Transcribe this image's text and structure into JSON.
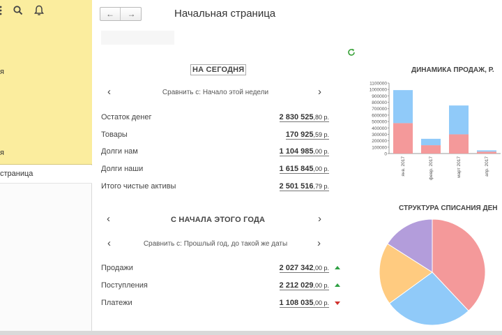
{
  "sidebar": {
    "icons": [
      "menu-icon",
      "search-icon",
      "bell-icon"
    ],
    "snippet_1": "я",
    "snippet_2": "я",
    "active_tab": "страница"
  },
  "header": {
    "back_label": "←",
    "forward_label": "→",
    "title": "Начальная страница"
  },
  "today": {
    "title": "НА СЕГОДНЯ",
    "compare": "Сравнить с: Начало этой недели",
    "rows": [
      {
        "label": "Остаток денег",
        "int": "2 830 525",
        "dec": ",80 р."
      },
      {
        "label": "Товары",
        "int": "170 925",
        "dec": ",59 р."
      },
      {
        "label": "Долги нам",
        "int": "1 104 985",
        "dec": ",00 р."
      },
      {
        "label": "Долги наши",
        "int": "1 615 845",
        "dec": ",00 р."
      },
      {
        "label": "Итого чистые активы",
        "int": "2 501 516",
        "dec": ",79 р."
      }
    ]
  },
  "year": {
    "title": "С НАЧАЛА ЭТОГО ГОДА",
    "compare": "Сравнить с: Прошлый год, до такой же даты",
    "rows": [
      {
        "label": "Продажи",
        "int": "2 027 342",
        "dec": ",00 р.",
        "trend": "up"
      },
      {
        "label": "Поступления",
        "int": "2 212 029",
        "dec": ",00 р.",
        "trend": "up"
      },
      {
        "label": "Платежи",
        "int": "1 108 035",
        "dec": ",00 р.",
        "trend": "down"
      }
    ]
  },
  "colors": {
    "sidebar_yellow": "#fbed9e",
    "bar_blue": "#90caf9",
    "bar_red": "#f4999a",
    "trend_up": "#2ea043",
    "trend_down": "#d0312d"
  },
  "chart_data": [
    {
      "type": "bar",
      "title": "ДИНАМИКА ПРОДАЖ, Р.",
      "stacked": true,
      "categories": [
        "янв. 2017",
        "февр. 2017",
        "март 2017",
        "апр. 2017"
      ],
      "series": [
        {
          "color": "#f4999a",
          "values": [
            475000,
            130000,
            300000,
            30000
          ]
        },
        {
          "color": "#90caf9",
          "values": [
            515000,
            100000,
            450000,
            20000
          ]
        }
      ],
      "ylim": [
        0,
        1100000
      ],
      "ticks": [
        "1100000",
        "1000000",
        "900000",
        "800000",
        "700000",
        "600000",
        "500000",
        "400000",
        "300000",
        "200000",
        "100000",
        "0"
      ],
      "grid": false
    },
    {
      "type": "pie",
      "title": "СТРУКТУРА СПИСАНИЯ ДЕН",
      "slices": [
        {
          "value": 38,
          "color": "#f4999a"
        },
        {
          "value": 27,
          "color": "#90caf9"
        },
        {
          "value": 19,
          "color": "#ffcb80"
        },
        {
          "value": 16,
          "color": "#b39ddb"
        }
      ]
    }
  ]
}
